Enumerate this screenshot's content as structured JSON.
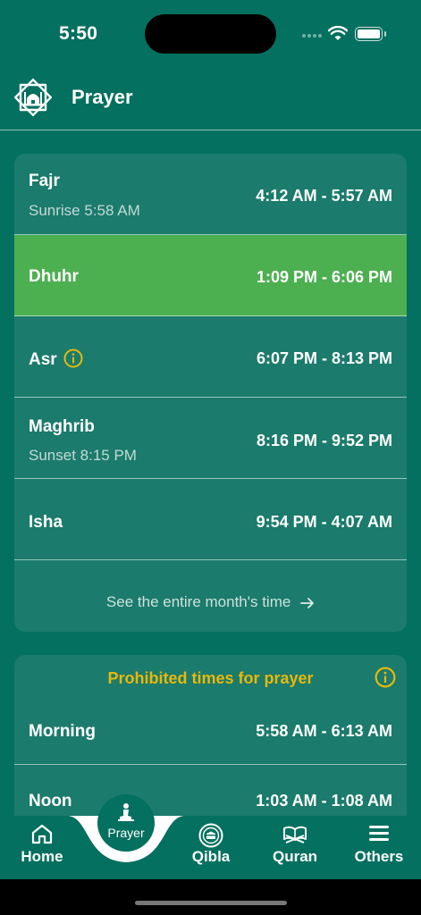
{
  "status_bar": {
    "time": "5:50"
  },
  "header": {
    "title": "Prayer",
    "logo_icon": "mosque-icon"
  },
  "prayers": [
    {
      "name": "Fajr",
      "sub": "Sunrise 5:58 AM",
      "time": "4:12 AM - 5:57 AM",
      "active": false
    },
    {
      "name": "Dhuhr",
      "sub": "",
      "time": "1:09 PM - 6:06 PM",
      "active": true
    },
    {
      "name": "Asr",
      "sub": "",
      "time": "6:07 PM - 8:13 PM",
      "active": false,
      "info": true
    },
    {
      "name": "Maghrib",
      "sub": "Sunset 8:15 PM",
      "time": "8:16 PM - 9:52 PM",
      "active": false
    },
    {
      "name": "Isha",
      "sub": "",
      "time": "9:54 PM - 4:07 AM",
      "active": false
    }
  ],
  "see_month_label": "See the entire month's time",
  "prohibited": {
    "title": "Prohibited times for prayer",
    "items": [
      {
        "name": "Morning",
        "time": "5:58 AM - 6:13 AM"
      },
      {
        "name": "Noon",
        "time": "1:03 AM - 1:08 AM"
      }
    ]
  },
  "nav": {
    "home": "Home",
    "prayer": "Prayer",
    "qibla": "Qibla",
    "quran": "Quran",
    "others": "Others"
  },
  "colors": {
    "background": "#04705f",
    "card": "#1b7b6c",
    "active_row": "#4caf50",
    "accent_yellow": "#e8b80b"
  }
}
